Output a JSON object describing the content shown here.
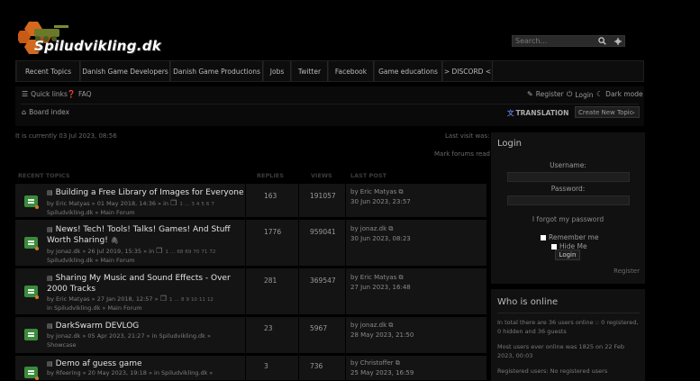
{
  "site": {
    "logo_text": "Spiludvikling.dk"
  },
  "search": {
    "placeholder": "Search...",
    "search_icon": "search-icon",
    "settings_icon": "gear-icon"
  },
  "nav": {
    "items": [
      {
        "label": "Recent Topics"
      },
      {
        "label": "Danish Game Developers"
      },
      {
        "label": "Danish Game Productions"
      },
      {
        "label": "Jobs"
      },
      {
        "label": "Twitter"
      },
      {
        "label": "Facebook"
      },
      {
        "label": "Game educations"
      },
      {
        "label": "> DISCORD <"
      }
    ]
  },
  "subnav": {
    "quick_links": "Quick links",
    "faq": "FAQ",
    "register": "Register",
    "login": "Login",
    "dark_mode": "Dark mode",
    "board_index": "Board index",
    "translation": "TRANSLATION",
    "create_topic": "Create New Topic"
  },
  "info": {
    "current_time": "It is currently 03 Jul 2023, 08:56",
    "last_visit": "Last visit was:",
    "mark_read": "Mark forums read"
  },
  "table": {
    "headers": {
      "topics": "RECENT TOPICS",
      "replies": "REPLIES",
      "views": "VIEWS",
      "last_post": "LAST POST"
    },
    "topics": [
      {
        "title": "Building a Free Library of Images for Everyone",
        "meta1": "by Eric Matyas » 01 May 2018, 14:36 » in",
        "pages": [
          "1",
          "…",
          "3",
          "4",
          "5",
          "6",
          "7"
        ],
        "meta2": "Spiludvikling.dk » Main Forum",
        "replies": "163",
        "views": "191057",
        "last_by": "by Eric Matyas",
        "last_date": "30 Jun 2023, 23:57"
      },
      {
        "title": "News! Tech! Tools! Talks! Games! And Stuff Worth Sharing!",
        "meta1": "by jonaz.dk » 26 Jul 2019, 15:35 » in",
        "pages": [
          "1",
          "…",
          "68",
          "69",
          "70",
          "71",
          "72"
        ],
        "meta2": "Spiludvikling.dk » Main Forum",
        "replies": "1776",
        "views": "959041",
        "last_by": "by jonaz.dk",
        "last_date": "30 Jun 2023, 08:23"
      },
      {
        "title": "Sharing My Music and Sound Effects - Over 2000 Tracks",
        "meta1": "by Eric Matyas » 27 Jan 2018, 12:57 »",
        "pages": [
          "1",
          "…",
          "8",
          "9",
          "10",
          "11",
          "12"
        ],
        "meta2": "in Spiludvikling.dk » Main Forum",
        "replies": "281",
        "views": "369547",
        "last_by": "by Eric Matyas",
        "last_date": "27 Jun 2023, 16:48"
      },
      {
        "title": "DarkSwarm DEVLOG",
        "meta1": "by jonaz.dk » 05 Apr 2023, 21:27 » in Spiludvikling.dk »",
        "pages": [],
        "meta2": "Showcase",
        "replies": "23",
        "views": "5967",
        "last_by": "by jonaz.dk",
        "last_date": "28 May 2023, 21:50"
      },
      {
        "title": "Demo af guess game",
        "meta1": "by Rfeering » 20 May 2023, 19:18 » in Spiludvikling.dk »",
        "pages": [],
        "meta2": "",
        "replies": "3",
        "views": "736",
        "last_by": "by Christoffer",
        "last_date": "25 May 2023, 16:59"
      }
    ]
  },
  "login_panel": {
    "title": "Login",
    "username": "Username:",
    "password": "Password:",
    "forgot": "I forgot my password",
    "remember": "Remember me",
    "hide": "Hide Me",
    "button": "Login",
    "register": "Register"
  },
  "online_panel": {
    "title": "Who is online",
    "line1": "In total there are 36 users online :: 0 registered, 0 hidden and 36 guests",
    "line2": "Most users ever online was 1825 on 22 Feb 2023, 00:03",
    "line3": "Registered users: No registered users"
  },
  "colors": {
    "accent_green": "#3c8a3c",
    "dot_orange": "#d27a2a",
    "translation_blue": "#5b7cd1"
  }
}
